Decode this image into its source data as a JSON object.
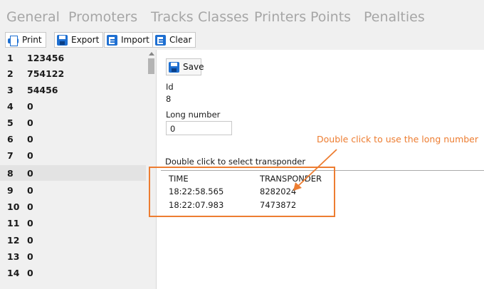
{
  "tabs": [
    "General",
    "Promoters",
    "Tracks",
    "Classes",
    "Printers",
    "Points",
    "Penalties"
  ],
  "toolbar": {
    "print_label": "Print",
    "export_label": "Export",
    "import_label": "Import",
    "clear_label": "Clear"
  },
  "list": {
    "rows": [
      {
        "index": "1",
        "value": "123456"
      },
      {
        "index": "2",
        "value": "754122"
      },
      {
        "index": "3",
        "value": "54456"
      },
      {
        "index": "4",
        "value": "0"
      },
      {
        "index": "5",
        "value": "0"
      },
      {
        "index": "6",
        "value": "0"
      },
      {
        "index": "7",
        "value": "0"
      },
      {
        "index": "8",
        "value": "0"
      },
      {
        "index": "9",
        "value": "0"
      },
      {
        "index": "10",
        "value": "0"
      },
      {
        "index": "11",
        "value": "0"
      },
      {
        "index": "12",
        "value": "0"
      },
      {
        "index": "13",
        "value": "0"
      },
      {
        "index": "14",
        "value": "0"
      }
    ],
    "selected_index": "8"
  },
  "detail": {
    "save_label": "Save",
    "id_label": "Id",
    "id_value": "8",
    "long_number_label": "Long number",
    "long_number_value": "0",
    "transponder_hint": "Double click to select transponder",
    "columns": [
      "TIME",
      "TRANSPONDER"
    ],
    "rows": [
      {
        "time": "18:22:58.565",
        "transponder": "8282024"
      },
      {
        "time": "18:22:07.983",
        "transponder": "7473872"
      }
    ]
  },
  "annotation": {
    "text": "Double click to use the long number",
    "color": "#ed7d31"
  },
  "icons": {
    "print": "printer-icon",
    "export": "save-disk-icon",
    "import": "import-doc-icon",
    "clear": "clear-doc-icon",
    "save": "save-disk-icon"
  }
}
